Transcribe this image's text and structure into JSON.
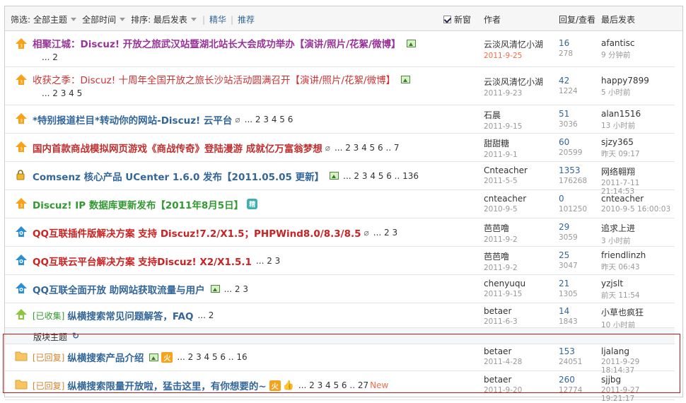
{
  "filters": {
    "label": "筛选:",
    "all_topics": "全部主题",
    "all_time": "全部时间",
    "sort": "排序: 最后发表",
    "digest": "精华",
    "recommend": "推荐"
  },
  "header": {
    "new_window": "新窗",
    "author": "作者",
    "replies_views": "回复/查看",
    "last_post": "最后发表"
  },
  "section_label": "版块主题",
  "colors": {
    "purple": "#993399",
    "red": "#cc3333",
    "blue": "#336699",
    "green": "#339933",
    "darkred": "#c03030",
    "crimson": "#cc2222"
  },
  "threads": [
    {
      "icon": "announce-icon",
      "tag": "",
      "title": "相聚江城：Discuz! 开放之旅武汉站暨湖北站长大会成功举办【演讲/照片/花絮/微博】",
      "pages": "... 2",
      "author": "云淡风清忆小湖",
      "date": "2011-9-25",
      "replies": "16",
      "views": "278",
      "last_user": "afantisc",
      "last_time": "9 分钟前"
    },
    {
      "icon": "announce-icon",
      "tag": "",
      "title": "收获之季：Discuz! 十周年全国开放之旅长沙站活动圆满召开【演讲/照片/花絮/微博】",
      "pages": "... 2 3 4 5",
      "author": "云淡风清忆小湖",
      "date": "2011-9-23",
      "replies": "42",
      "views": "1224",
      "last_user": "happy7899",
      "last_time": "5 小时前"
    },
    {
      "icon": "announce-icon",
      "tag": "",
      "title": "*特别报道栏目*转动你的网站-Discuz! 云平台",
      "pages": "... 2 3 4 5 6",
      "author": "石晨",
      "date": "2011-9-15",
      "replies": "51",
      "views": "3036",
      "last_user": "alan1516",
      "last_time": "13 小时前"
    },
    {
      "icon": "announce-icon",
      "tag": "",
      "title": "国内首款商战模拟网页游戏《商战传奇》登陆漫游 成就亿万富翁梦想",
      "pages": "... 2 3 4 5 6 .. 7",
      "author": "甜甜糖",
      "date": "2011-9-1",
      "replies": "60",
      "views": "20599",
      "last_user": "sjzy365",
      "last_time": "昨天 09:17"
    },
    {
      "icon": "lock-icon",
      "tag": "",
      "title": "Comsenz 核心产品 UCenter 1.6.0 发布【2011.05.05 更新】",
      "pages": "... 2 3 4 5 6 .. 136",
      "author": "Cnteacher",
      "date": "2011-5-5",
      "replies": "1353",
      "views": "176268",
      "last_user": "网络翱翔",
      "last_time": "2011-7-11 21:14:53"
    },
    {
      "icon": "announce-icon",
      "tag": "",
      "title": "Discuz! IP 数据库更新发布【2011年8月5日】",
      "pages": "",
      "author": "cnteacher",
      "date": "2010-9-5",
      "replies": "0",
      "views": "101250",
      "last_user": "cnteacher",
      "last_time": "2010-9-5 16:00:03"
    },
    {
      "icon": "qq-icon",
      "tag": "",
      "title": "QQ互联插件版解决方案 支持 Discuz!7.2/X1.5；PHPWind8.0/8.3/8.5",
      "pages": "... 2 3",
      "author": "芭芭噜",
      "date": "2011-9-2",
      "replies": "29",
      "views": "3059",
      "last_user": "追求上进",
      "last_time": "3 小时前"
    },
    {
      "icon": "qq-icon",
      "tag": "",
      "title": "QQ互联云平台解决方案 支持Discuz! X2/X1.5.1",
      "pages": "... 2 3",
      "author": "芭芭噜",
      "date": "2011-9-2",
      "replies": "25",
      "views": "3047",
      "last_user": "friendlinzh",
      "last_time": "昨天 06:43"
    },
    {
      "icon": "qq-icon",
      "tag": "",
      "title": "QQ互联全面开放 助网站获取流量与用户",
      "pages": "... 2 3",
      "author": "chenyuqu",
      "date": "2011-9-15",
      "replies": "21",
      "views": "1305",
      "last_user": "yzjslt",
      "last_time": "前天 11:54"
    },
    {
      "icon": "collect-icon",
      "tag": "[已收集]",
      "title": "纵横搜索常见问题解答，FAQ",
      "pages": "... 2",
      "author": "betaer",
      "date": "2011-6-3",
      "replies": "14",
      "views": "1843",
      "last_user": "小草也疯狂",
      "last_time": "10 小时前"
    },
    {
      "icon": "folder-icon",
      "tag": "[已回复]",
      "title": "纵横搜索产品介绍",
      "pages": "... 2 3 4 5 6 .. 16",
      "author": "betaer",
      "date": "2011-4-28",
      "replies": "153",
      "views": "24051",
      "last_user": "ljalang",
      "last_time": "2011-9-29 18:14:37"
    },
    {
      "icon": "folder-icon",
      "tag": "[已回复]",
      "title": "纵横搜索限量开放啦，猛击这里，有你想要的~",
      "pages": "... 2 3 4 5 6 .. 27",
      "new_label": "New",
      "author": "betaer",
      "date": "2011-9-20",
      "replies": "260",
      "views": "12774",
      "last_user": "sjjbg",
      "last_time": "2011-9-27 19:21:17"
    }
  ]
}
